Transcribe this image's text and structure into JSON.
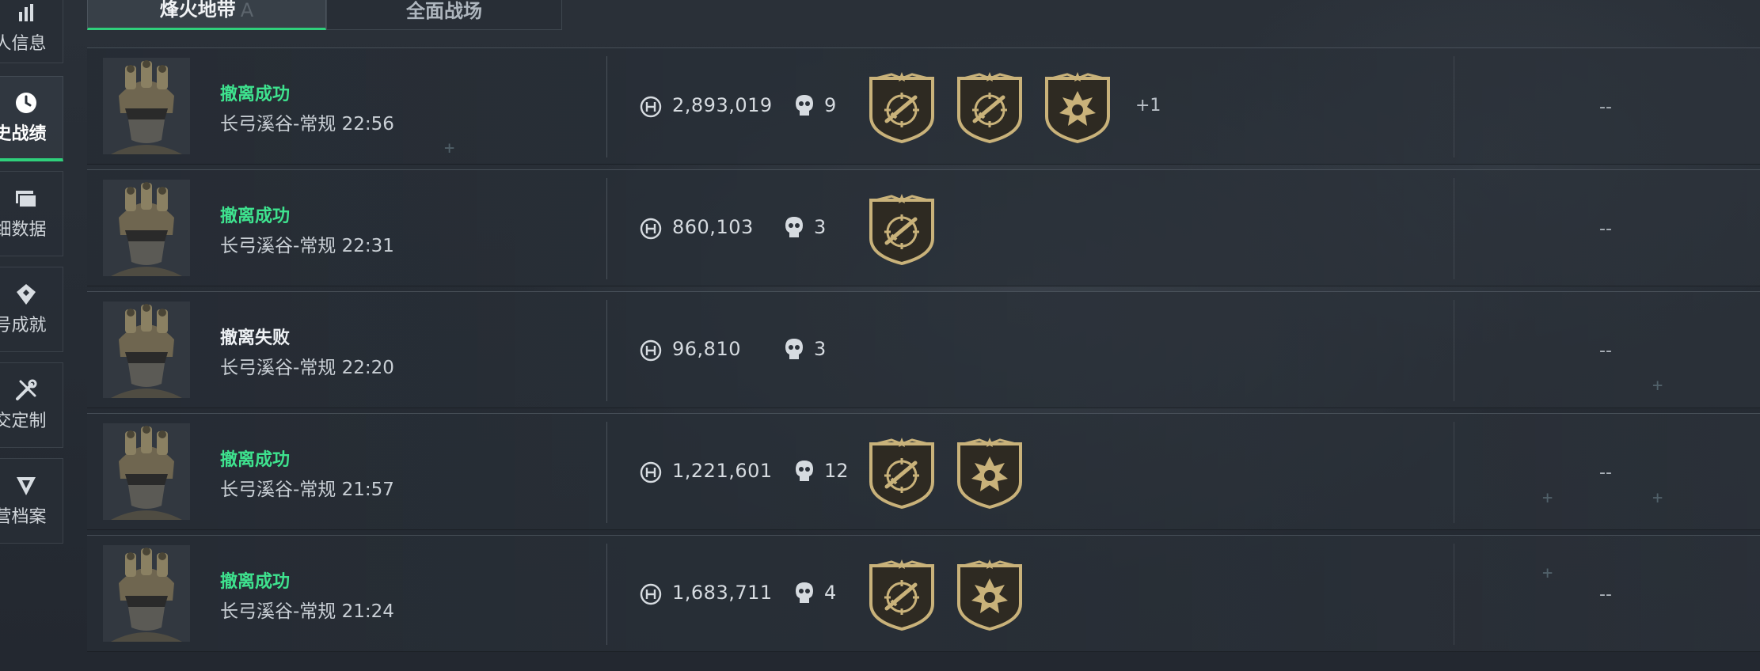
{
  "sidebar": {
    "items": [
      {
        "label": "人信息",
        "icon": "stats-bar-icon",
        "active": false
      },
      {
        "label": "史战绩",
        "icon": "clock-icon",
        "active": true
      },
      {
        "label": "细数据",
        "icon": "folder-icon",
        "active": false
      },
      {
        "label": "号成就",
        "icon": "achievement-icon",
        "active": false
      },
      {
        "label": "交定制",
        "icon": "tools-icon",
        "active": false
      },
      {
        "label": "营档案",
        "icon": "emblem-icon",
        "active": false
      }
    ]
  },
  "tabs": [
    {
      "label": "烽火地带",
      "active": true,
      "ghost": "A"
    },
    {
      "label": "全面战场",
      "active": false
    }
  ],
  "matches": [
    {
      "status": "撤离成功",
      "success": true,
      "map": "长弓溪谷-常规 22:56",
      "value": "2,893,019",
      "kills": "9",
      "badges": [
        "rifle-target-badge-icon",
        "rifle-target-badge-icon",
        "skull-star-badge-icon"
      ],
      "extra": "+1",
      "right": "--"
    },
    {
      "status": "撤离成功",
      "success": true,
      "map": "长弓溪谷-常规 22:31",
      "value": "860,103",
      "kills": "3",
      "badges": [
        "rifle-target-badge-icon"
      ],
      "extra": "",
      "right": "--"
    },
    {
      "status": "撤离失败",
      "success": false,
      "map": "长弓溪谷-常规 22:20",
      "value": "96,810",
      "kills": "3",
      "badges": [],
      "extra": "",
      "right": "--"
    },
    {
      "status": "撤离成功",
      "success": true,
      "map": "长弓溪谷-常规 21:57",
      "value": "1,221,601",
      "kills": "12",
      "badges": [
        "rifle-target-badge-icon",
        "skull-star-badge-icon"
      ],
      "extra": "",
      "right": "--"
    },
    {
      "status": "撤离成功",
      "success": true,
      "map": "长弓溪谷-常规 21:24",
      "value": "1,683,711",
      "kills": "4",
      "badges": [
        "rifle-target-badge-icon",
        "skull-star-badge-icon"
      ],
      "extra": "",
      "right": "--"
    }
  ],
  "colors": {
    "success": "#3ee28e",
    "accent": "#2fd07b",
    "badge_gold": "#c9b27a"
  }
}
